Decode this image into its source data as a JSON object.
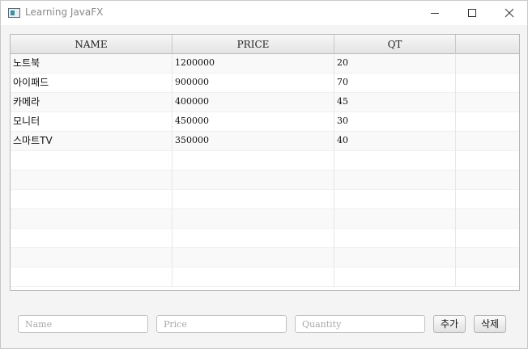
{
  "window": {
    "title": "Learning JavaFX"
  },
  "table": {
    "columns": [
      "NAME",
      "PRICE",
      "QT"
    ],
    "rows": [
      {
        "name": "노트북",
        "price": "1200000",
        "qt": "20"
      },
      {
        "name": "아이패드",
        "price": "900000",
        "qt": "70"
      },
      {
        "name": "카메라",
        "price": "400000",
        "qt": "45"
      },
      {
        "name": "모니터",
        "price": "450000",
        "qt": "30"
      },
      {
        "name": "스마트TV",
        "price": "350000",
        "qt": "40"
      }
    ],
    "empty_row_count": 7
  },
  "form": {
    "name_placeholder": "Name",
    "price_placeholder": "Price",
    "qty_placeholder": "Quantity",
    "add_label": "추가",
    "delete_label": "삭제"
  },
  "icons": {
    "app": "app-window-icon",
    "minimize": "minimize-icon",
    "maximize": "maximize-icon",
    "close": "close-icon"
  }
}
